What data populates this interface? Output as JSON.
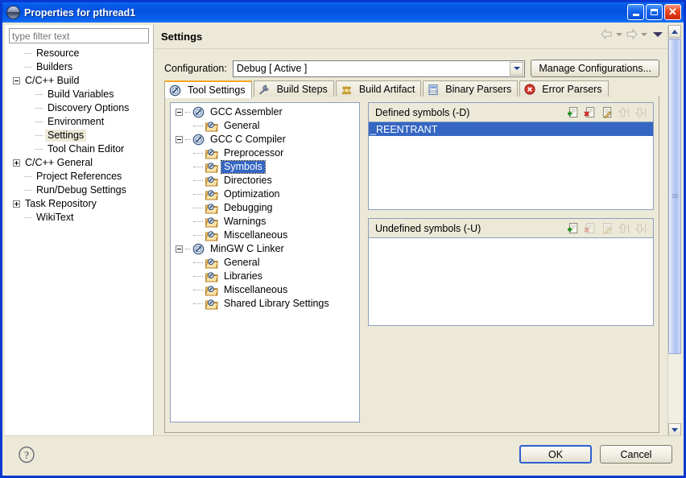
{
  "window": {
    "title": "Properties for pthread1",
    "icon": "eclipse-sphere-icon",
    "minimize_label": "_",
    "maximize_label": "□",
    "close_label": "✕"
  },
  "sidebar": {
    "filter": {
      "placeholder": "type filter text",
      "value": ""
    },
    "items": [
      {
        "label": "Resource",
        "indent": 1,
        "toggle": "none",
        "selected": false
      },
      {
        "label": "Builders",
        "indent": 1,
        "toggle": "none",
        "selected": false
      },
      {
        "label": "C/C++ Build",
        "indent": 0,
        "toggle": "minus",
        "selected": false
      },
      {
        "label": "Build Variables",
        "indent": 2,
        "toggle": "none",
        "selected": false
      },
      {
        "label": "Discovery Options",
        "indent": 2,
        "toggle": "none",
        "selected": false
      },
      {
        "label": "Environment",
        "indent": 2,
        "toggle": "none",
        "selected": false
      },
      {
        "label": "Settings",
        "indent": 2,
        "toggle": "none",
        "selected": true
      },
      {
        "label": "Tool Chain Editor",
        "indent": 2,
        "toggle": "none",
        "selected": false
      },
      {
        "label": "C/C++ General",
        "indent": 0,
        "toggle": "plus",
        "selected": false
      },
      {
        "label": "Project References",
        "indent": 1,
        "toggle": "none",
        "selected": false
      },
      {
        "label": "Run/Debug Settings",
        "indent": 1,
        "toggle": "none",
        "selected": false
      },
      {
        "label": "Task Repository",
        "indent": 0,
        "toggle": "plus",
        "selected": false
      },
      {
        "label": "WikiText",
        "indent": 1,
        "toggle": "none",
        "selected": false
      }
    ]
  },
  "pane": {
    "title": "Settings",
    "nav": {
      "back_icon": "back-arrow-icon",
      "back_menu_icon": "chevron-down-icon",
      "forward_icon": "forward-arrow-icon",
      "forward_menu_icon": "chevron-down-icon",
      "menu_icon": "view-menu-icon"
    },
    "configuration": {
      "label": "Configuration:",
      "value": "Debug  [ Active ]",
      "manage_button": "Manage Configurations..."
    },
    "tabs": [
      {
        "label": "Tool Settings",
        "icon": "compass-icon",
        "active": true
      },
      {
        "label": "Build Steps",
        "icon": "wrench-icon",
        "active": false
      },
      {
        "label": "Build Artifact",
        "icon": "artifact-icon",
        "active": false
      },
      {
        "label": "Binary Parsers",
        "icon": "binary-file-icon",
        "active": false
      },
      {
        "label": "Error Parsers",
        "icon": "error-icon",
        "active": false
      }
    ]
  },
  "tool_tree": [
    {
      "label": "GCC Assembler",
      "level": 0,
      "toggle": "minus",
      "icon": "compass-icon",
      "selected": false
    },
    {
      "label": "General",
      "level": 1,
      "toggle": "none",
      "icon": "folder-tool-icon",
      "selected": false
    },
    {
      "label": "GCC C Compiler",
      "level": 0,
      "toggle": "minus",
      "icon": "compass-icon",
      "selected": false
    },
    {
      "label": "Preprocessor",
      "level": 1,
      "toggle": "none",
      "icon": "folder-tool-icon",
      "selected": false
    },
    {
      "label": "Symbols",
      "level": 1,
      "toggle": "none",
      "icon": "folder-tool-icon",
      "selected": true
    },
    {
      "label": "Directories",
      "level": 1,
      "toggle": "none",
      "icon": "folder-tool-icon",
      "selected": false
    },
    {
      "label": "Optimization",
      "level": 1,
      "toggle": "none",
      "icon": "folder-tool-icon",
      "selected": false
    },
    {
      "label": "Debugging",
      "level": 1,
      "toggle": "none",
      "icon": "folder-tool-icon",
      "selected": false
    },
    {
      "label": "Warnings",
      "level": 1,
      "toggle": "none",
      "icon": "folder-tool-icon",
      "selected": false
    },
    {
      "label": "Miscellaneous",
      "level": 1,
      "toggle": "none",
      "icon": "folder-tool-icon",
      "selected": false
    },
    {
      "label": "MinGW C Linker",
      "level": 0,
      "toggle": "minus",
      "icon": "compass-icon",
      "selected": false
    },
    {
      "label": "General",
      "level": 1,
      "toggle": "none",
      "icon": "folder-tool-icon",
      "selected": false
    },
    {
      "label": "Libraries",
      "level": 1,
      "toggle": "none",
      "icon": "folder-tool-icon",
      "selected": false
    },
    {
      "label": "Miscellaneous",
      "level": 1,
      "toggle": "none",
      "icon": "folder-tool-icon",
      "selected": false
    },
    {
      "label": "Shared Library Settings",
      "level": 1,
      "toggle": "none",
      "icon": "folder-tool-icon",
      "selected": false
    }
  ],
  "defined_symbols": {
    "title": "Defined symbols (-D)",
    "tools": [
      {
        "name": "add-icon",
        "enabled": true
      },
      {
        "name": "delete-icon",
        "enabled": true
      },
      {
        "name": "edit-icon",
        "enabled": true
      },
      {
        "name": "move-up-icon",
        "enabled": false
      },
      {
        "name": "move-down-icon",
        "enabled": false
      }
    ],
    "items": [
      {
        "value": "_REENTRANT",
        "selected": true
      }
    ]
  },
  "undefined_symbols": {
    "title": "Undefined symbols (-U)",
    "tools": [
      {
        "name": "add-icon",
        "enabled": true
      },
      {
        "name": "delete-icon",
        "enabled": false
      },
      {
        "name": "edit-icon",
        "enabled": false
      },
      {
        "name": "move-up-icon",
        "enabled": false
      },
      {
        "name": "move-down-icon",
        "enabled": false
      }
    ],
    "items": []
  },
  "footer": {
    "help_icon": "help-question-icon",
    "ok_label": "OK",
    "cancel_label": "Cancel"
  },
  "colors": {
    "title_bar": "#0a5ceb",
    "dialog_bg": "#ece9d8",
    "selection_blue": "#3566c4",
    "active_tab_accent": "#f5a623",
    "border": "#8ca0bc"
  }
}
